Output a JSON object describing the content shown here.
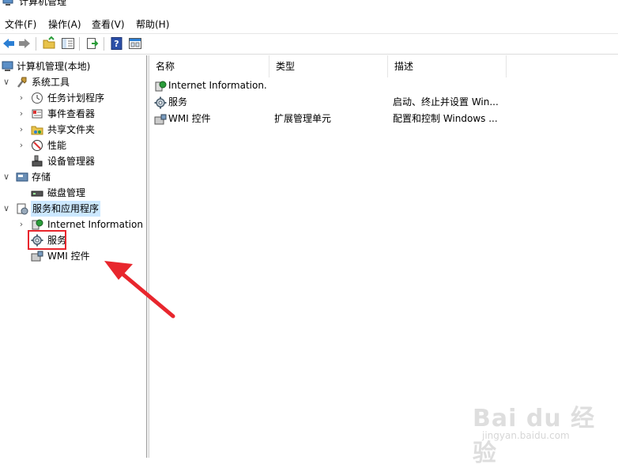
{
  "window": {
    "title": "计算机管理"
  },
  "menu": {
    "items": [
      "文件(F)",
      "操作(A)",
      "查看(V)",
      "帮助(H)"
    ]
  },
  "toolbar": {
    "buttons": [
      "back-icon",
      "forward-icon",
      "up-folder-icon",
      "show-tree-icon",
      "export-icon",
      "help-icon",
      "properties-icon"
    ]
  },
  "tree": {
    "root": "计算机管理(本地)",
    "items": [
      {
        "label": "系统工具",
        "level": 1,
        "expanded": true
      },
      {
        "label": "任务计划程序",
        "level": 2
      },
      {
        "label": "事件查看器",
        "level": 2
      },
      {
        "label": "共享文件夹",
        "level": 2
      },
      {
        "label": "性能",
        "level": 2
      },
      {
        "label": "设备管理器",
        "level": 2
      },
      {
        "label": "存储",
        "level": 1,
        "expanded": true
      },
      {
        "label": "磁盘管理",
        "level": 2
      },
      {
        "label": "服务和应用程序",
        "level": 1,
        "expanded": true,
        "selected": true
      },
      {
        "label": "Internet Information S",
        "level": 2
      },
      {
        "label": "服务",
        "level": 2,
        "highlighted": true
      },
      {
        "label": "WMI 控件",
        "level": 2
      }
    ]
  },
  "list": {
    "columns": [
      "名称",
      "类型",
      "描述"
    ],
    "rows": [
      {
        "name": "Internet Information...",
        "type": "",
        "desc": ""
      },
      {
        "name": "服务",
        "type": "",
        "desc": "启动、终止并设置 Win..."
      },
      {
        "name": "WMI 控件",
        "type": "扩展管理单元",
        "desc": "配置和控制 Windows ..."
      }
    ]
  },
  "watermark": {
    "main": "Bai du 经验",
    "sub": "jingyan.baidu.com"
  },
  "colors": {
    "selection": "#cce8ff",
    "annotation_red": "#e8262d"
  }
}
